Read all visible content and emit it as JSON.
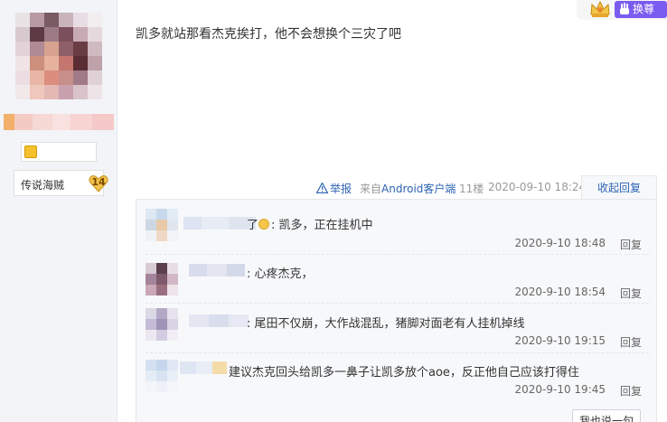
{
  "header": {
    "swap_label": "换尊"
  },
  "author": {
    "level_name": "传说海贼",
    "level_number": "14"
  },
  "post": {
    "text": "凯多就站那看杰克挨打，他不会想换个三灾了吧",
    "report_label": "举报",
    "client_prefix": "来自",
    "client_name": "Android客户端",
    "floor": "11楼",
    "time": "2020-09-10 18:24",
    "collapse_label": "收起回复"
  },
  "replies": [
    {
      "content": "了",
      "content_rest": "凯多，正在挂机中",
      "time": "2020-9-10 18:48",
      "reply_label": "回复"
    },
    {
      "content": ": 心疼杰克，",
      "time": "2020-9-10 18:54",
      "reply_label": "回复"
    },
    {
      "content": ": 尾田不仅崩，大作战混乱，猪脚对面老有人挂机掉线",
      "time": "2020-9-10 19:15",
      "reply_label": "回复"
    },
    {
      "content": "建议杰克回头给凯多一鼻子让凯多放个aoe，反正他自己应该打得住",
      "time": "2020-9-10 19:45",
      "reply_label": "回复"
    }
  ],
  "reply_box": {
    "say_label": "我也说一句"
  },
  "colors": {
    "link": "#2d64b3",
    "sidebar_bg": "#f2f4f8",
    "reply_bg": "#f7f8fa",
    "swap_bg": "#7b5cf0"
  },
  "icons": {
    "crown": "crown-icon",
    "hand": "hand-icon",
    "warning": "warning-icon",
    "coin": "coin-icon",
    "level": "heart-badge-icon",
    "emoji": "emoji-icon"
  }
}
